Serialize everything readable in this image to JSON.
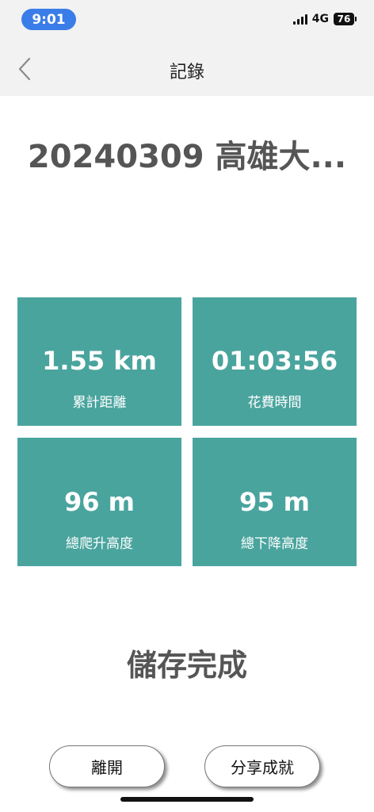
{
  "status_bar": {
    "time": "9:01",
    "network": "4G",
    "battery": "76"
  },
  "nav": {
    "title": "記錄"
  },
  "record": {
    "title": "20240309 高雄大..."
  },
  "stats": {
    "distance": {
      "value": "1.55 km",
      "label": "累計距離"
    },
    "duration": {
      "value": "01:03:56",
      "label": "花費時間"
    },
    "ascent": {
      "value": "96 m",
      "label": "總爬升高度"
    },
    "descent": {
      "value": "95 m",
      "label": "總下降高度"
    }
  },
  "save_status": "儲存完成",
  "actions": {
    "leave_label": "離開",
    "share_label": "分享成就"
  },
  "colors": {
    "card_bg": "#4aa49e",
    "time_pill": "#3a7de8",
    "header_bg": "#f2f2f2",
    "title_text": "#555555"
  }
}
